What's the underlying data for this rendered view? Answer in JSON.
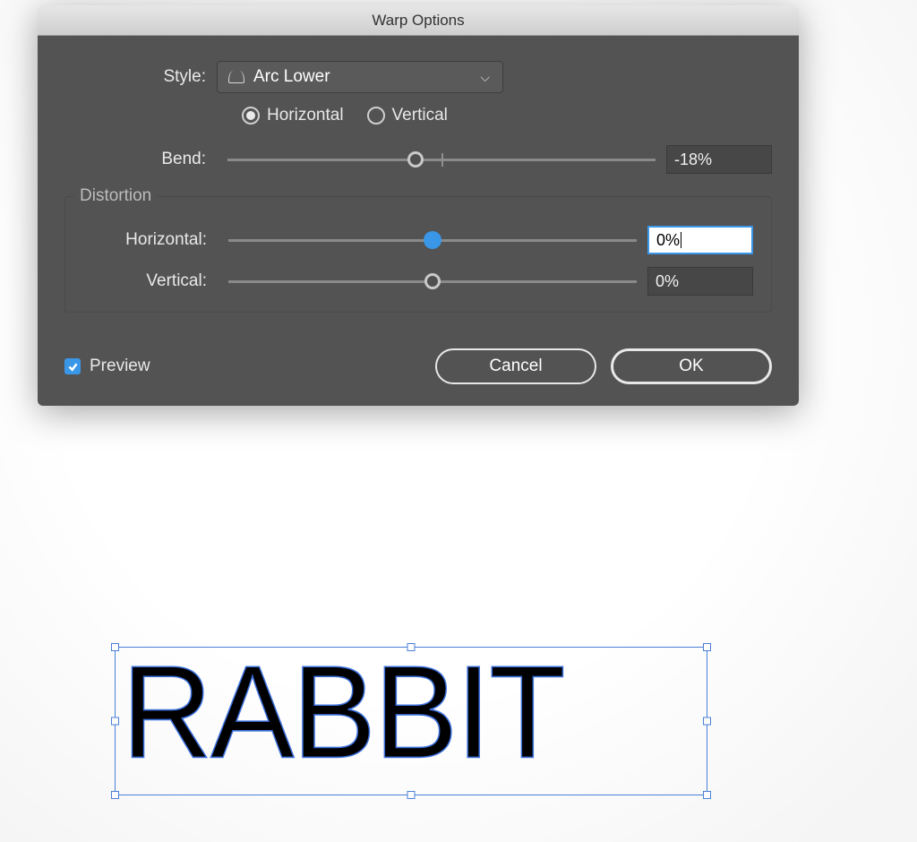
{
  "dialog": {
    "title": "Warp Options",
    "style_label": "Style:",
    "style_value": "Arc Lower",
    "orientation": {
      "horizontal": "Horizontal",
      "vertical": "Vertical",
      "selected": "horizontal"
    },
    "bend": {
      "label": "Bend:",
      "value": "-18%",
      "thumb_pct": 44
    },
    "distortion": {
      "legend": "Distortion",
      "horizontal": {
        "label": "Horizontal:",
        "value": "0%",
        "thumb_pct": 50,
        "focused": true
      },
      "vertical": {
        "label": "Vertical:",
        "value": "0%",
        "thumb_pct": 50,
        "focused": false
      }
    },
    "preview": {
      "label": "Preview",
      "checked": true
    },
    "buttons": {
      "cancel": "Cancel",
      "ok": "OK"
    }
  },
  "canvas": {
    "text": "RABBIT"
  }
}
